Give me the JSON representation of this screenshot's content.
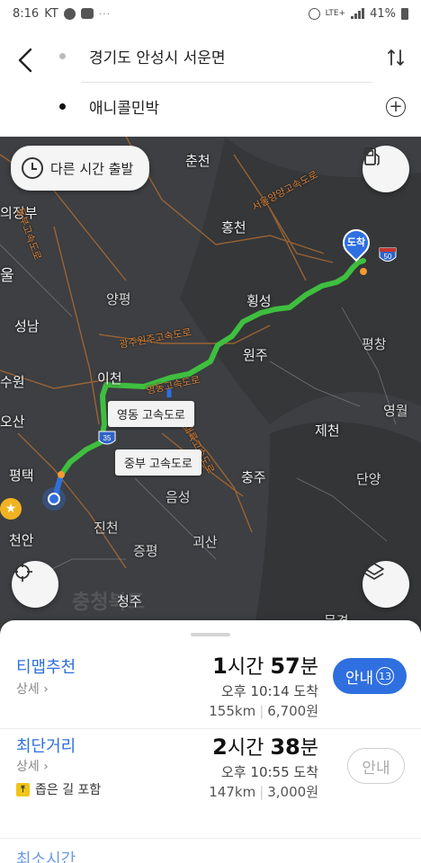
{
  "status_bar": {
    "time": "8:16",
    "carrier": "KT",
    "extra": "···",
    "network": "LTE+",
    "battery": "41%"
  },
  "route": {
    "origin": "경기도 안성시 서운면",
    "destination": "애니콜민박"
  },
  "map": {
    "depart_time_button": "다른 시간 출발",
    "destination_marker": "도착",
    "cities": [
      {
        "name": "춘천"
      },
      {
        "name": "의정부"
      },
      {
        "name": "홍천"
      },
      {
        "name": "울"
      },
      {
        "name": "양평"
      },
      {
        "name": "횡성"
      },
      {
        "name": "성남"
      },
      {
        "name": "원주"
      },
      {
        "name": "평창"
      },
      {
        "name": "이천"
      },
      {
        "name": "수원"
      },
      {
        "name": "영월"
      },
      {
        "name": "오산"
      },
      {
        "name": "제천"
      },
      {
        "name": "평택"
      },
      {
        "name": "충주"
      },
      {
        "name": "단양"
      },
      {
        "name": "음성"
      },
      {
        "name": "진천"
      },
      {
        "name": "천안"
      },
      {
        "name": "괴산"
      },
      {
        "name": "증평"
      },
      {
        "name": "청주"
      },
      {
        "name": "문경"
      }
    ],
    "highways": [
      "서울양양고속도로",
      "광주원주고속도로",
      "영동고속도로",
      "중부내륙고속도로",
      "동부고속도로"
    ],
    "route_labels": {
      "yeongdong": "영동 고속도로",
      "jungbu": "중부 고속도로"
    },
    "shields": {
      "i35": "35",
      "i50": "50"
    },
    "region_watermark": "충청북도"
  },
  "options": [
    {
      "name": "티맵추천",
      "detail": "상세",
      "duration_hours": "1",
      "duration_hours_unit": "시간",
      "duration_minutes": "57",
      "duration_minutes_unit": "분",
      "arrival": "오후 10:14 도착",
      "distance": "155km",
      "toll": "6,700원",
      "button": "안내",
      "button_badge": "13"
    },
    {
      "name": "최단거리",
      "detail": "상세",
      "duration_hours": "2",
      "duration_hours_unit": "시간",
      "duration_minutes": "38",
      "duration_minutes_unit": "분",
      "arrival": "오후 10:55 도착",
      "distance": "147km",
      "toll": "3,000원",
      "button": "안내",
      "note_icon": "narrow-road-icon",
      "note": "좁은 길 포함"
    }
  ],
  "third_option_partial": "최소시간",
  "colors": {
    "accent": "#2f6fe0",
    "route": "#3fbf3f",
    "map_bg": "#3d3f42",
    "highway_label": "#d9843d"
  }
}
